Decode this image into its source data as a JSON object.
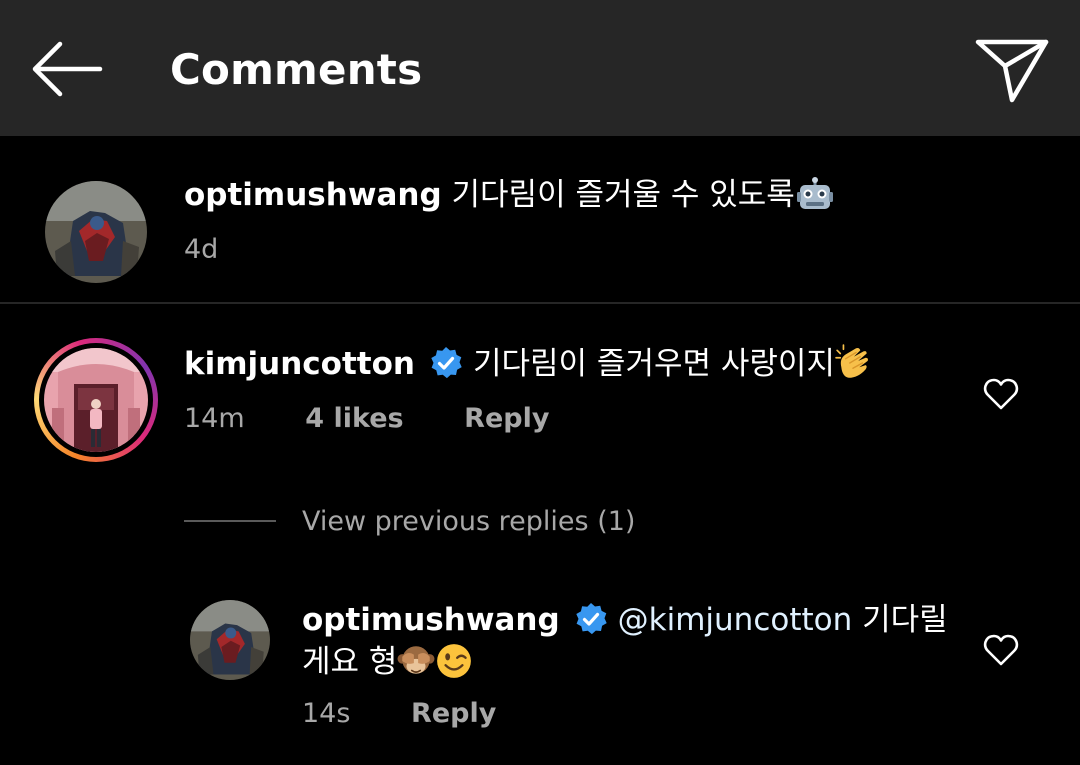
{
  "header": {
    "title": "Comments",
    "back_icon": "arrow-left-icon",
    "send_icon": "paper-plane-icon"
  },
  "comments": [
    {
      "username": "optimushwang",
      "verified": false,
      "text": "기다림이 즐거울 수 있도록",
      "emoji": "robot-emoji",
      "time": "4d",
      "likes": "",
      "reply_label": ""
    },
    {
      "username": "kimjuncotton",
      "verified": true,
      "text": "기다림이 즐거우면 사랑이지",
      "emoji": "clapping-hands-emoji",
      "time": "14m",
      "likes": "4 likes",
      "reply_label": "Reply",
      "view_previous_replies": "View previous replies (1)",
      "replies": [
        {
          "username": "optimushwang",
          "verified": true,
          "mention": "@kimjuncotton",
          "text_line1": "기다릴",
          "text_line2": "게요 형",
          "emojis": [
            "see-no-evil-monkey-emoji",
            "winking-face-emoji"
          ],
          "time": "14s",
          "reply_label": "Reply"
        }
      ]
    }
  ],
  "colors": {
    "background": "#000000",
    "header_background": "#262626",
    "primary_text": "#ffffff",
    "secondary_text": "#a8a8a8",
    "verified_blue": "#3897f0",
    "divider": "#262626"
  }
}
